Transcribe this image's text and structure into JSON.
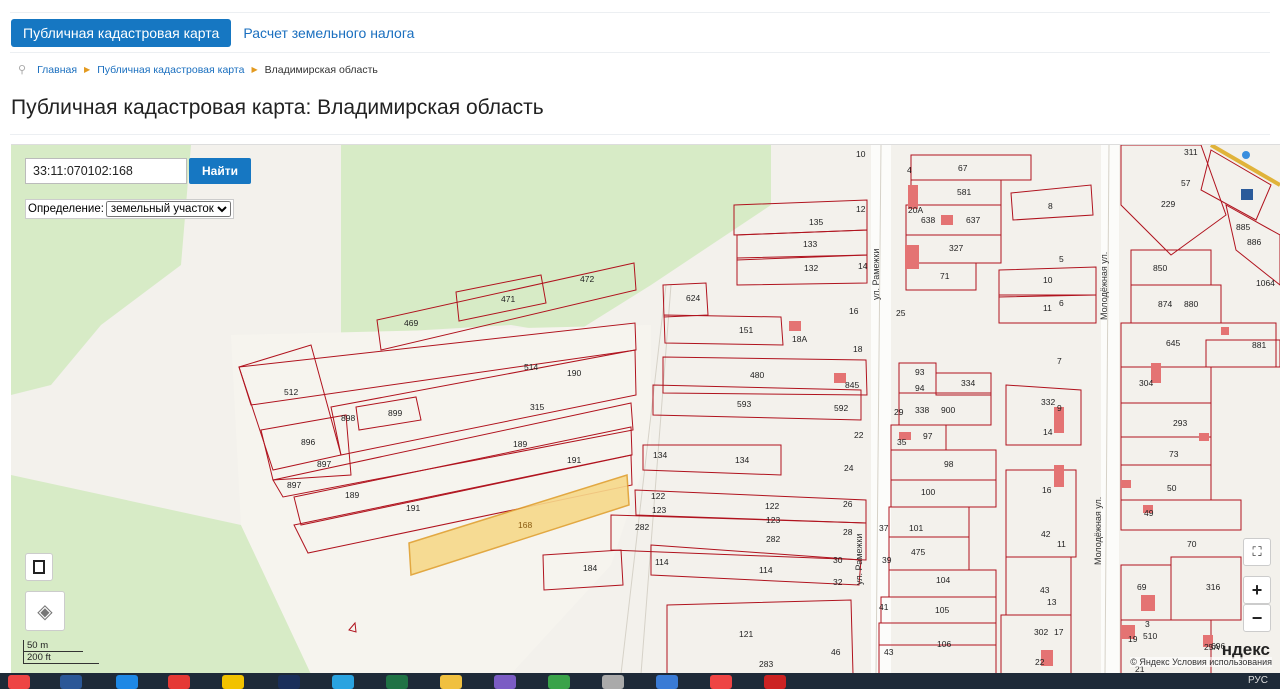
{
  "tabs": {
    "active": "Публичная кадастровая карта",
    "other": "Расчет земельного налога"
  },
  "breadcrumb": {
    "home": "Главная",
    "level2": "Публичная кадастровая карта",
    "current": "Владимирская область"
  },
  "page_title": "Публичная кадастровая карта: Владимирская область",
  "search": {
    "value": "33:11:070102:168",
    "button": "Найти"
  },
  "definition": {
    "label": "Определение:",
    "selected": "земельный участок"
  },
  "streets": {
    "s1": "ул. Рамежки",
    "s2": "ул. Рамежки",
    "s3": "Молодёжная ул.",
    "s4": "Молодёжная ул."
  },
  "parcel_labels": [
    "472",
    "471",
    "469",
    "624",
    "514",
    "190",
    "512",
    "315",
    "898",
    "899",
    "896",
    "189",
    "191",
    "897",
    "897",
    "189",
    "191",
    "168",
    "184",
    "151",
    "18А",
    "480",
    "845",
    "593",
    "592",
    "134",
    "134",
    "122",
    "123",
    "122",
    "123",
    "282",
    "282",
    "114",
    "114",
    "121",
    "283",
    "46",
    "43",
    "67",
    "581",
    "638",
    "637",
    "327",
    "71",
    "135",
    "133",
    "132",
    "93",
    "94",
    "334",
    "338",
    "900",
    "97",
    "98",
    "100",
    "101",
    "475",
    "104",
    "105",
    "106",
    "302",
    "22",
    "8",
    "10",
    "11",
    "332",
    "14",
    "16",
    "42",
    "43",
    "850",
    "874",
    "880",
    "645",
    "881",
    "304",
    "293",
    "73",
    "50",
    "49",
    "70",
    "69",
    "316",
    "510",
    "696",
    "311",
    "57",
    "229",
    "885",
    "886",
    "1064",
    "10",
    "12",
    "14",
    "16",
    "18",
    "22",
    "24",
    "26",
    "28",
    "30",
    "32",
    "25",
    "29",
    "35",
    "37",
    "39",
    "41",
    "5",
    "6",
    "7",
    "9",
    "11",
    "13",
    "17",
    "19",
    "21",
    "3",
    "4",
    "20А",
    "25А"
  ],
  "scale": {
    "metric": "50 m",
    "imperial": "200 ft"
  },
  "attribution": {
    "logo": "ндекс",
    "terms": "© Яндекс Условия использования"
  },
  "taskbar": {
    "lang": "РУС"
  },
  "colors": {
    "accent": "#1677c2",
    "parcel_stroke": "#b0131e",
    "highlight_fill": "#f7d98a",
    "forest": "#d7ebc6"
  }
}
